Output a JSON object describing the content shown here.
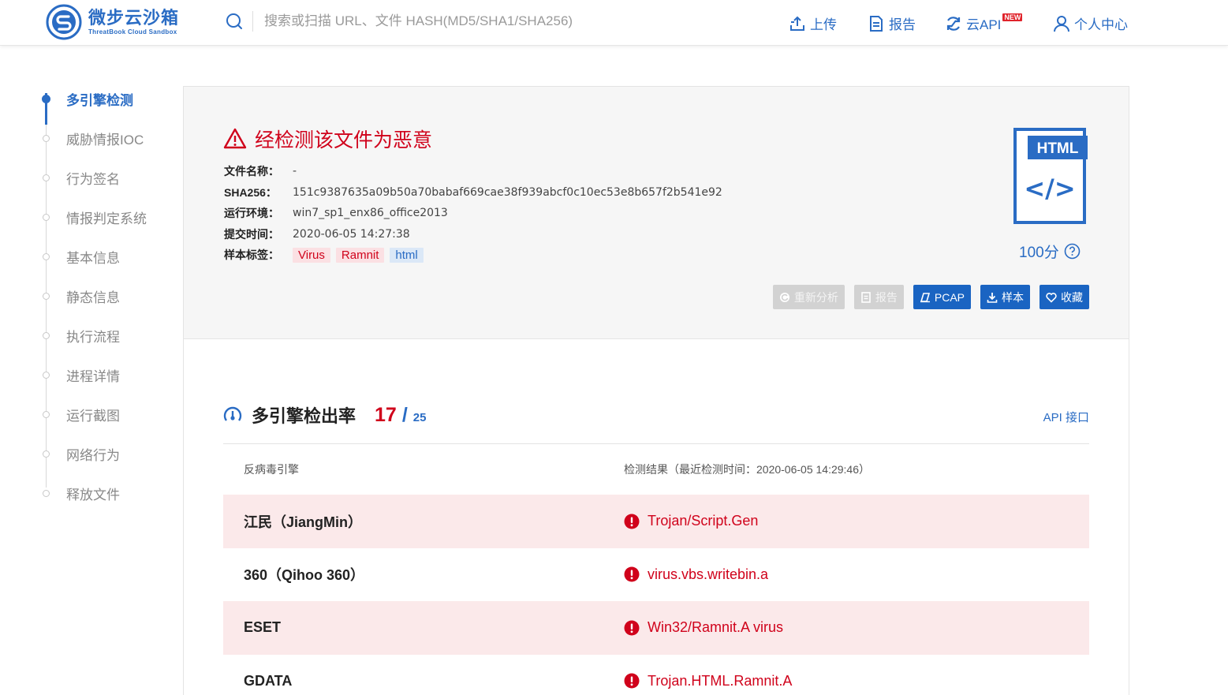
{
  "header": {
    "logo_cn": "微步云沙箱",
    "logo_en": "ThreatBook Cloud Sandbox",
    "search_placeholder": "搜索或扫描 URL、文件 HASH(MD5/SHA1/SHA256)",
    "nav": {
      "upload": "上传",
      "report": "报告",
      "cloud_api": "云API",
      "new_badge": "NEW",
      "user_center": "个人中心"
    }
  },
  "sidebar": {
    "items": [
      {
        "label": "多引擎检测",
        "active": true
      },
      {
        "label": "威胁情报IOC"
      },
      {
        "label": "行为签名"
      },
      {
        "label": "情报判定系统"
      },
      {
        "label": "基本信息"
      },
      {
        "label": "静态信息"
      },
      {
        "label": "执行流程"
      },
      {
        "label": "进程详情"
      },
      {
        "label": "运行截图"
      },
      {
        "label": "网络行为"
      },
      {
        "label": "释放文件"
      }
    ]
  },
  "summary": {
    "verdict": "经检测该文件为恶意",
    "file_name_key": "文件名称：",
    "file_name": "-",
    "sha256_key": "SHA256：",
    "sha256": "151c9387635a09b50a70babaf669cae38f939abcf0c10ec53e8b657f2b541e92",
    "env_key": "运行环境：",
    "env": "win7_sp1_enx86_office2013",
    "time_key": "提交时间：",
    "time": "2020-06-05 14:27:38",
    "tags_key": "样本标签：",
    "tags": [
      "Virus",
      "Ramnit",
      "html"
    ],
    "file_type": "HTML",
    "score": "100分",
    "buttons": {
      "reanalyze": "重新分析",
      "report": "报告",
      "pcap": "PCAP",
      "sample": "样本",
      "favorite": "收藏"
    }
  },
  "detection": {
    "title": "多引擎检出率",
    "hits": "17",
    "separator": "/",
    "total": "25",
    "api_link": "API 接口",
    "col_engine": "反病毒引擎",
    "col_result": "检测结果（最近检测时间：2020-06-05 14:29:46）",
    "rows": [
      {
        "engine": "江民（JiangMin）",
        "result": "Trojan/Script.Gen"
      },
      {
        "engine": "360（Qihoo 360）",
        "result": "virus.vbs.writebin.a"
      },
      {
        "engine": "ESET",
        "result": "Win32/Ramnit.A virus"
      },
      {
        "engine": "GDATA",
        "result": "Trojan.HTML.Ramnit.A"
      }
    ]
  },
  "colors": {
    "brand": "#2a6cc4",
    "danger": "#d0021b",
    "hit_row_bg": "#fbe9ea"
  }
}
